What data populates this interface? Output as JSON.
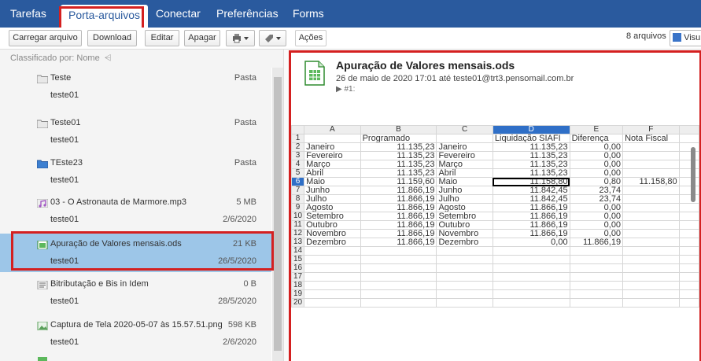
{
  "nav": {
    "tabs": [
      "Tarefas",
      "Porta-arquivos",
      "Conectar",
      "Preferências",
      "Forms"
    ],
    "active": "Porta-arquivos"
  },
  "toolbar": {
    "upload": "Carregar arquivo",
    "download": "Download",
    "edit": "Editar",
    "delete": "Apagar",
    "actions": "Ações",
    "count": "8 arquivos",
    "view": "Visu"
  },
  "list": {
    "sort_label": "Classificado por: Nome",
    "items": [
      {
        "name": "Teste",
        "size": "Pasta",
        "owner": "teste01",
        "date": "",
        "icon": "folder-icon"
      },
      {
        "name": "Teste01",
        "size": "Pasta",
        "owner": "teste01",
        "date": "",
        "icon": "folder-icon"
      },
      {
        "name": "TEste23",
        "size": "Pasta",
        "owner": "teste01",
        "date": "",
        "icon": "shared-folder-icon"
      },
      {
        "name": "03 - O Astronauta de Marmore.mp3",
        "size": "5 MB",
        "owner": "teste01",
        "date": "2/6/2020",
        "icon": "audio-file-icon"
      },
      {
        "name": "Apuração de Valores mensais.ods",
        "size": "21 KB",
        "owner": "teste01",
        "date": "26/5/2020",
        "icon": "spreadsheet-file-icon"
      },
      {
        "name": "Bitributação e Bis in Idem",
        "size": "0 B",
        "owner": "teste01",
        "date": "28/5/2020",
        "icon": "document-file-icon"
      },
      {
        "name": "Captura de Tela 2020-05-07 às 15.57.51.png",
        "size": "598 KB",
        "owner": "teste01",
        "date": "2/6/2020",
        "icon": "image-file-icon"
      }
    ]
  },
  "preview": {
    "title": "Apuração de Valores mensais.ods",
    "meta": "26 de maio de 2020 17:01 até teste01@trt3.pensomail.com.br",
    "version": "▶ #1:"
  },
  "sheet": {
    "columns": [
      "A",
      "B",
      "C",
      "D",
      "E",
      "F"
    ],
    "rows": [
      [
        "",
        "Programado",
        "",
        "Liquidação SIAFI",
        "Diferença",
        "Nota Fiscal"
      ],
      [
        "Janeiro",
        "11.135,23",
        "Janeiro",
        "11.135,23",
        "0,00",
        ""
      ],
      [
        "Fevereiro",
        "11.135,23",
        "Fevereiro",
        "11.135,23",
        "0,00",
        ""
      ],
      [
        "Março",
        "11.135,23",
        "Março",
        "11.135,23",
        "0,00",
        ""
      ],
      [
        "Abril",
        "11.135,23",
        "Abril",
        "11.135,23",
        "0,00",
        ""
      ],
      [
        "Maio",
        "11.159,60",
        "Maio",
        "11.158,80",
        "0,80",
        "11.158,80"
      ],
      [
        "Junho",
        "11.866,19",
        "Junho",
        "11.842,45",
        "23,74",
        ""
      ],
      [
        "Julho",
        "11.866,19",
        "Julho",
        "11.842,45",
        "23,74",
        ""
      ],
      [
        "Agosto",
        "11.866,19",
        "Agosto",
        "11.866,19",
        "0,00",
        ""
      ],
      [
        "Setembro",
        "11.866,19",
        "Setembro",
        "11.866,19",
        "0,00",
        ""
      ],
      [
        "Outubro",
        "11.866,19",
        "Outubro",
        "11.866,19",
        "0,00",
        ""
      ],
      [
        "Novembro",
        "11.866,19",
        "Novembro",
        "11.866,19",
        "0,00",
        ""
      ],
      [
        "Dezembro",
        "11.866,19",
        "Dezembro",
        "0,00",
        "11.866,19",
        ""
      ],
      [
        "",
        "",
        "",
        "",
        "",
        ""
      ],
      [
        "",
        "",
        "",
        "",
        "",
        ""
      ],
      [
        "",
        "",
        "",
        "",
        "",
        ""
      ],
      [
        "",
        "",
        "",
        "",
        "",
        ""
      ],
      [
        "",
        "",
        "",
        "",
        "",
        ""
      ],
      [
        "",
        "",
        "",
        "",
        "",
        ""
      ],
      [
        "",
        "",
        "",
        "",
        "",
        ""
      ]
    ],
    "active_row": 6,
    "active_col": "D"
  }
}
